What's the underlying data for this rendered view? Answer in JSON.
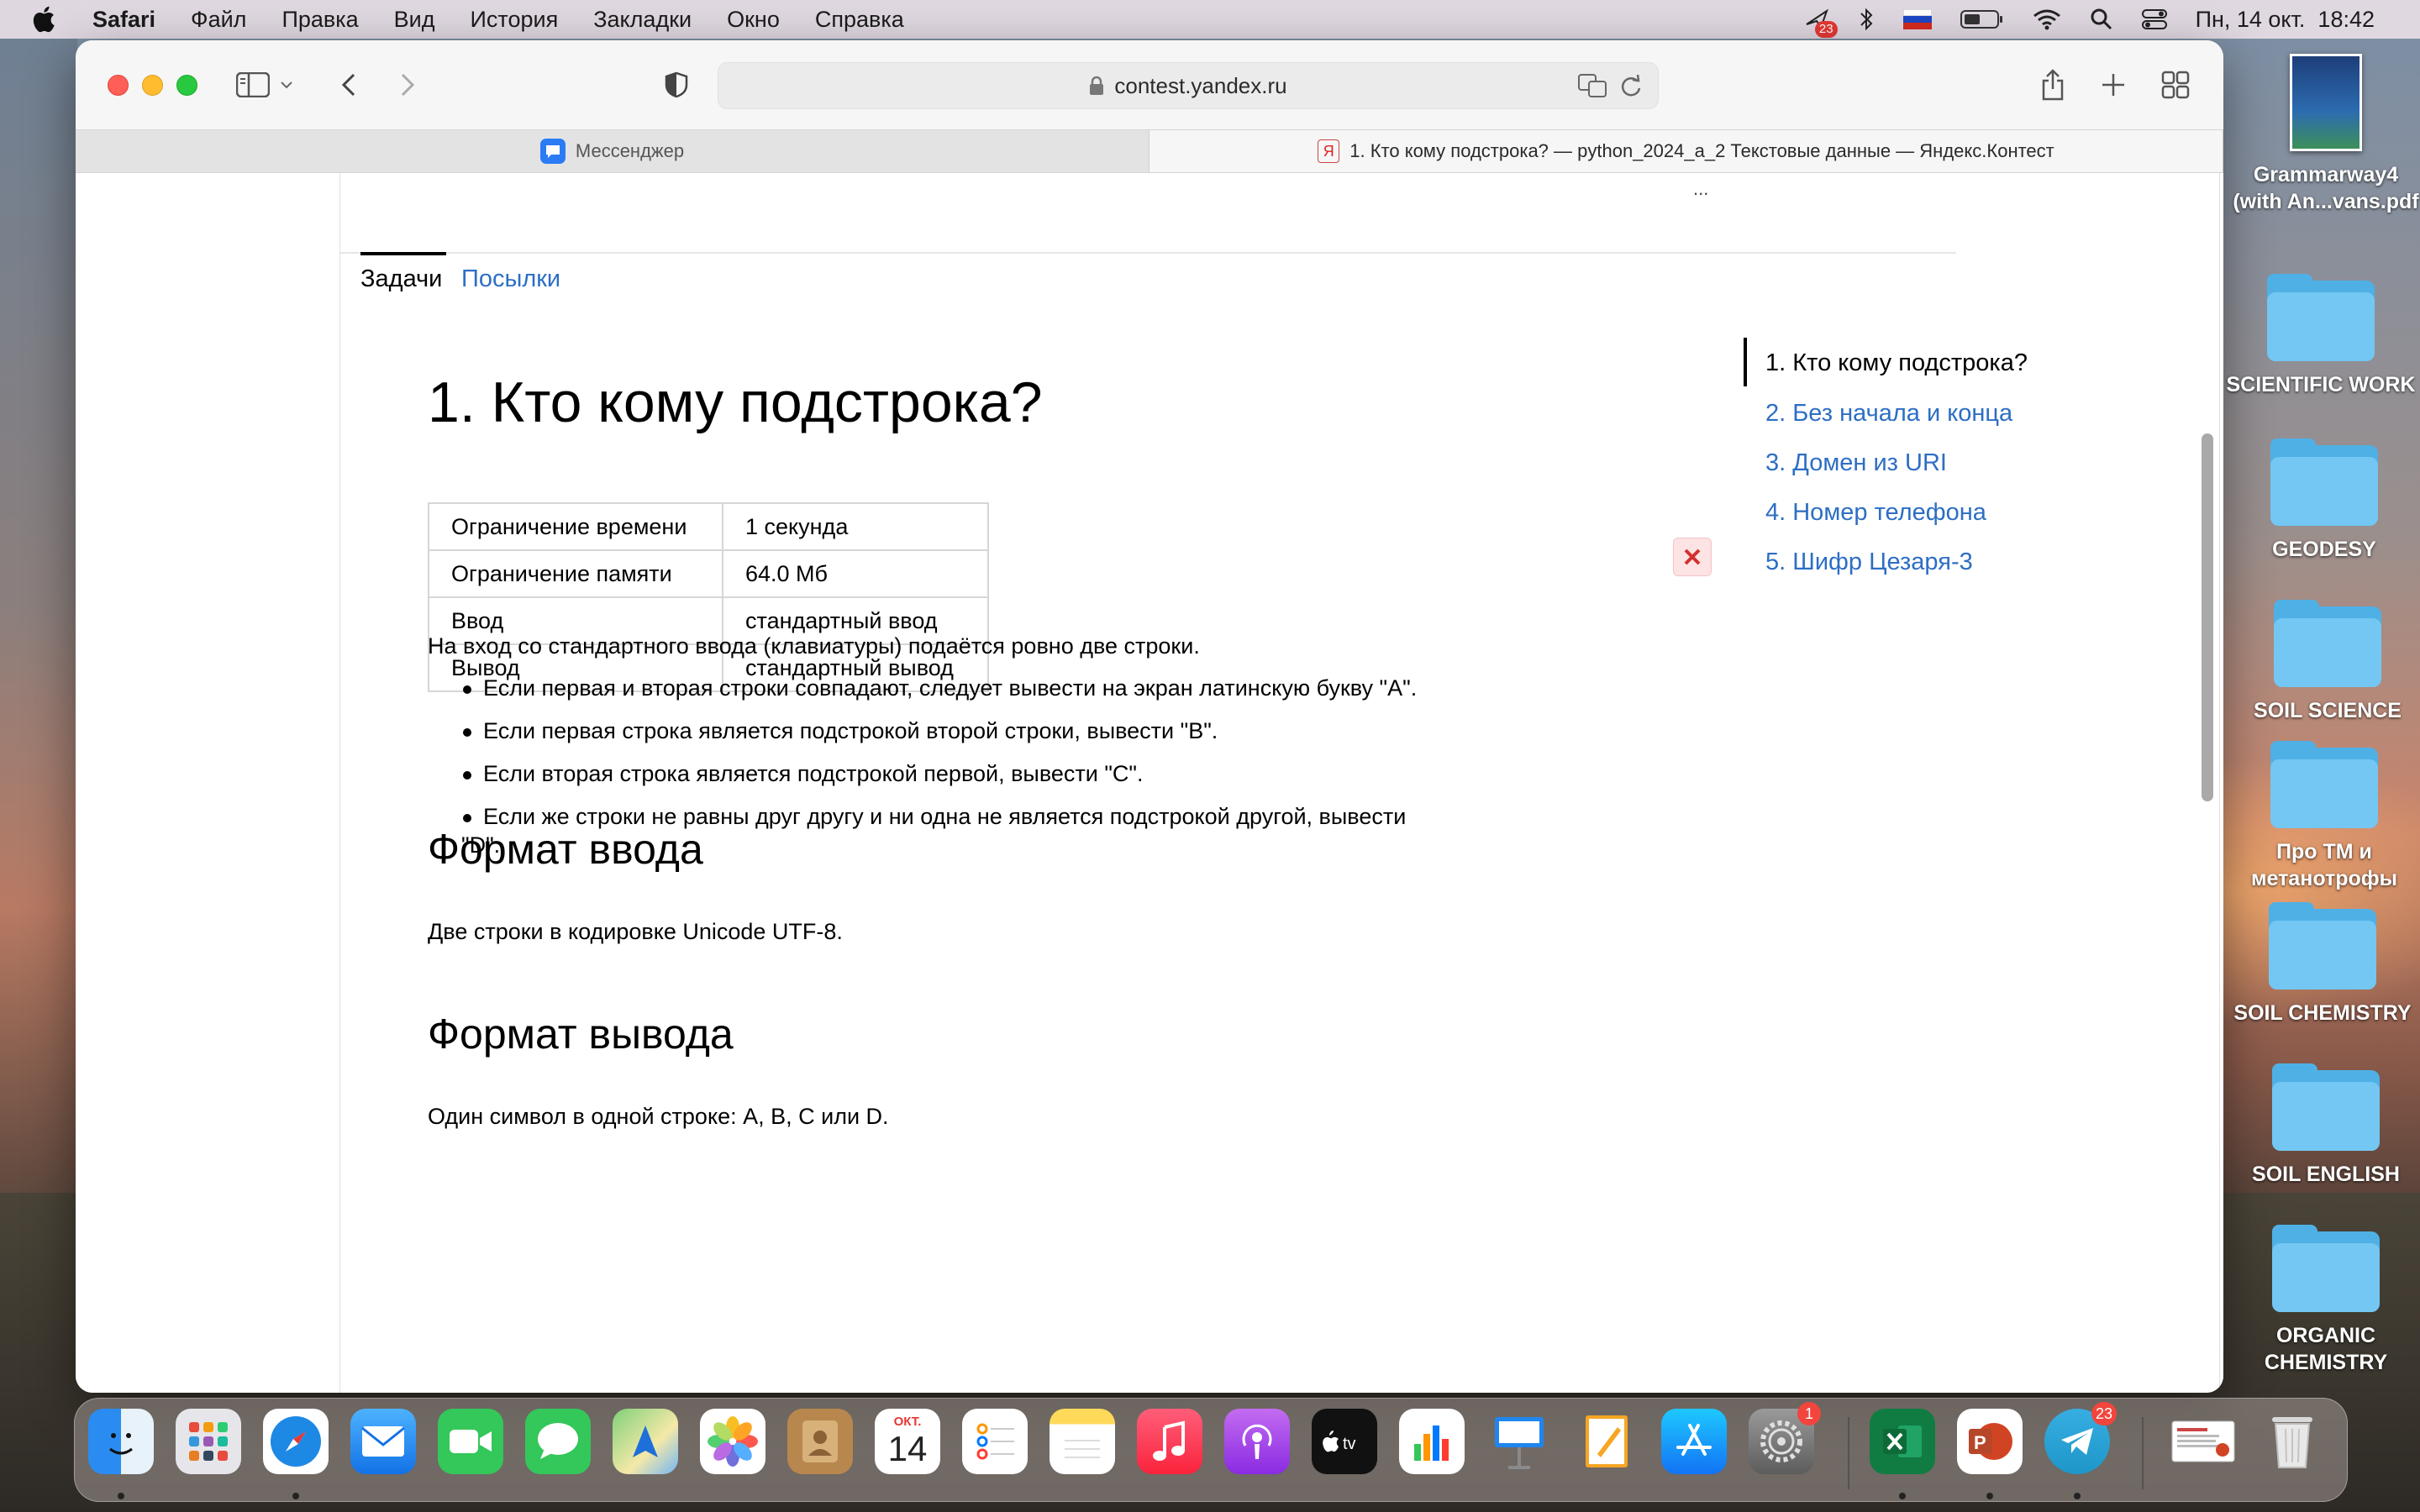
{
  "menubar": {
    "app": "Safari",
    "items": [
      "Файл",
      "Правка",
      "Вид",
      "История",
      "Закладки",
      "Окно",
      "Справка"
    ],
    "notification_badge": "23",
    "datetime": "Пн, 14 окт.  18:42"
  },
  "browser": {
    "url": "contest.yandex.ru",
    "tabs": [
      {
        "label": "Мессенджер",
        "active": false
      },
      {
        "label": "1. Кто кому подстрока? — python_2024_a_2 Текстовые данные — Яндекс.Контест",
        "active": true
      }
    ]
  },
  "page": {
    "ellipsis": "...",
    "nav_tabs": {
      "problems": "Задачи",
      "submissions": "Посылки"
    },
    "title": "1. Кто кому подстрока?",
    "limits": [
      {
        "label": "Ограничение времени",
        "value": "1 секунда"
      },
      {
        "label": "Ограничение памяти",
        "value": "64.0 Мб"
      },
      {
        "label": "Ввод",
        "value": "стандартный ввод"
      },
      {
        "label": "Вывод",
        "value": "стандартный вывод"
      }
    ],
    "statement_intro": "На вход со стандартного ввода (клавиатуры) подаётся ровно две строки.",
    "rules": [
      "Если первая и вторая строки совпадают, следует вывести на экран латинскую букву \"A\".",
      "Если первая строка является подстрокой второй строки, вывести \"B\".",
      "Если вторая строка является подстрокой первой, вывести \"C\".",
      "Если же строки не равны друг другу и ни одна не является подстрокой другой, вывести"
    ],
    "rule4_cont": "\"D\".",
    "input_heading": "Формат ввода",
    "input_text": "Две строки в кодировке Unicode UTF-8.",
    "output_heading": "Формат вывода",
    "output_text": "Один символ в одной строке: A, B, C или D.",
    "toc": [
      "1. Кто кому подстрока?",
      "2. Без начала и конца",
      "3. Домен из URI",
      "4. Номер телефона",
      "5. Шифр Цезаря-3"
    ]
  },
  "desktop": {
    "items": [
      {
        "label_line1": "Grammarway4",
        "label_line2": "(with An...vans.pdf"
      },
      {
        "label_line1": "SCIENTIFIC WORK"
      },
      {
        "label_line1": "GEODESY"
      },
      {
        "label_line1": "SOIL SCIENCE"
      },
      {
        "label_line1": "Про ТМ и",
        "label_line2": "метанотрофы"
      },
      {
        "label_line1": "SOIL CHEMISTRY"
      },
      {
        "label_line1": "SOIL ENGLISH"
      },
      {
        "label_line1": "ORGANIC",
        "label_line2": "CHEMISTRY"
      }
    ]
  },
  "dock": {
    "calendar_month": "ОКТ.",
    "calendar_day": "14",
    "settings_badge": "1",
    "telegram_badge": "23"
  }
}
